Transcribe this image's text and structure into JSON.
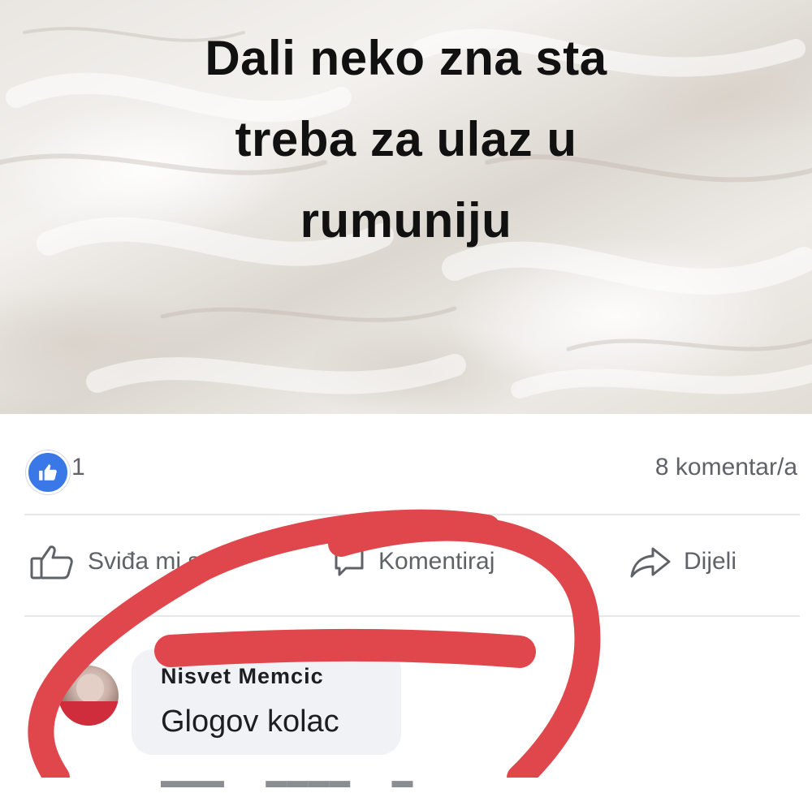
{
  "post": {
    "text_lines": [
      "Dali neko zna sta",
      "treba za ulaz u",
      "rumuniju"
    ]
  },
  "reactions": {
    "like_icon": "like-badge-icon",
    "like_count": "1",
    "comments_count": "8 komentar/a"
  },
  "actions": {
    "like_label": "Sviđa mi se",
    "comment_label": "Komentiraj",
    "share_label": "Dijeli"
  },
  "comment": {
    "author": "Nisvet Memcic",
    "text": "Glogov kolac"
  },
  "colors": {
    "like_blue": "#3b78e7",
    "scribble_red": "#e0474c",
    "bubble_gray": "#f0f2f5"
  }
}
